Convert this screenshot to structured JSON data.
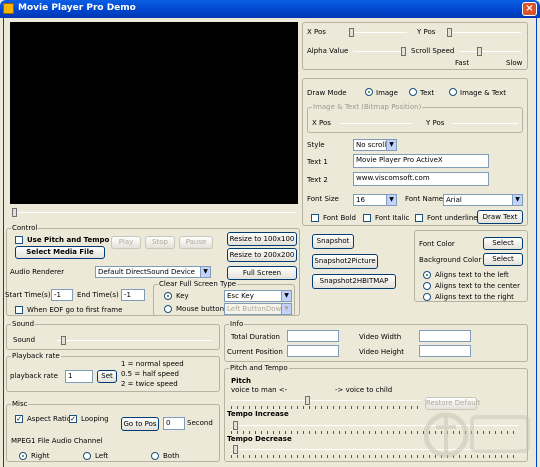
{
  "window": {
    "title": "Movie Player Pro Demo"
  },
  "sliders": {
    "x_pos": "X Pos",
    "y_pos": "Y Pos",
    "alpha_value": "Alpha Value",
    "scroll_speed": "Scroll Speed",
    "fast": "Fast",
    "slow": "Slow"
  },
  "draw": {
    "mode_label": "Draw Mode",
    "mode_image": "Image",
    "mode_text": "Text",
    "mode_both": "Image & Text",
    "pos_group": "Image & Text (Bitmap Position)",
    "x_pos": "X Pos",
    "y_pos": "Y Pos",
    "style_label": "Style",
    "style_value": "No scroll",
    "text1_label": "Text 1",
    "text1_value": "Movie Player Pro ActiveX",
    "text2_label": "Text 2",
    "text2_value": "www.viscomsoft.com",
    "font_size_label": "Font Size",
    "font_size_value": "16",
    "font_name_label": "Font Name",
    "font_name_value": "Arial",
    "font_bold": "Font Bold",
    "font_italic": "Font Italic",
    "font_underline": "Font underline",
    "draw_text_btn": "Draw Text"
  },
  "snap": {
    "snapshot": "Snapshot",
    "snapshot2picture": "Snapshot2Picture",
    "snapshot2hbitmap": "Snapshot2HBITMAP",
    "font_color": "Font Color",
    "bg_color": "Background Color",
    "select": "Select",
    "align_left": "Aligns text to the left",
    "align_center": "Aligns text to the center",
    "align_right": "Aligns text to the right"
  },
  "control": {
    "group": "Control",
    "use_pitch": "Use Pitch and Tempo",
    "select_media": "Select Media File",
    "play": "Play",
    "stop": "Stop",
    "pause": "Pause",
    "resize100": "Resize to 100x100",
    "resize200": "Resize to 200x200",
    "full_screen": "Full Screen",
    "audio_renderer": "Audio Renderer",
    "audio_value": "Default DirectSound Device",
    "start_time": "Start Time(s)",
    "start_value": "-1",
    "end_time": "End Time(s)",
    "end_value": "-1",
    "eof_first": "When EOF go to first frame",
    "clear_group": "Clear Full Screen Type",
    "key": "Key",
    "key_value": "Esc Key",
    "mouse": "Mouse button",
    "mouse_value": "Left ButtonDown"
  },
  "sound": {
    "group": "Sound",
    "label": "Sound"
  },
  "rate": {
    "group": "Playback rate",
    "label": "playback rate",
    "value": "1",
    "set": "Set",
    "note1": "1 = normal speed",
    "note2": "0.5 = half speed",
    "note3": "2 = twice speed"
  },
  "misc": {
    "group": "Misc",
    "aspect": "Aspect Ratio",
    "looping": "Looping",
    "go_to_pos": "Go to Pos",
    "pos_value": "0",
    "second": "Second",
    "mpeg_label": "MPEG1 File Audio Channel",
    "right": "Right",
    "left": "Left",
    "both": "Both"
  },
  "info": {
    "group": "Info",
    "total": "Total Duration",
    "current": "Current Position",
    "vwidth": "Video Width",
    "vheight": "Video Height"
  },
  "pitch": {
    "group": "Pitch and Tempo",
    "pitch_label": "Pitch",
    "man": "voice to man <-",
    "child": "-> voice to child",
    "restore": "Restore Default",
    "tempo_inc": "Tempo Increase",
    "tempo_dec": "Tempo Decrease"
  }
}
